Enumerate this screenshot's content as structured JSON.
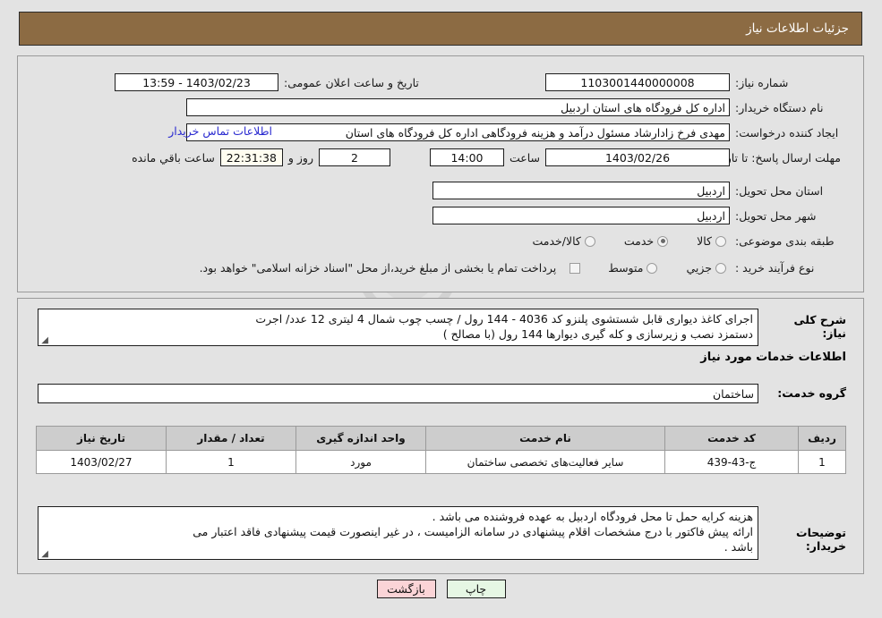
{
  "header": {
    "title": "جزئیات اطلاعات نیاز"
  },
  "form": {
    "need_number_label": "شماره نیاز:",
    "need_number_value": "1103001440000008",
    "public_announce_label": "تاریخ و ساعت اعلان عمومی:",
    "public_announce_value": "1403/02/23 - 13:59",
    "buyer_org_label": "نام دستگاه خریدار:",
    "buyer_org_value": "اداره کل فرودگاه های استان اردبیل",
    "creator_label": "ایجاد کننده درخواست:",
    "creator_value": "مهدی فرخ زادارشاد مسئول درآمد و هزینه فرودگاهی اداره کل فرودگاه های استان",
    "contact_link": "اطلاعات تماس خریدار",
    "deadline_label": "مهلت ارسال پاسخ: تا تاریخ:",
    "deadline_date": "1403/02/26",
    "hour_label": "ساعت",
    "deadline_time": "14:00",
    "days_value": "2",
    "days_label": "روز و",
    "countdown_value": "22:31:38",
    "countdown_label": "ساعت باقي مانده",
    "province_label": "استان محل تحویل:",
    "province_value": "اردبیل",
    "city_label": "شهر محل تحویل:",
    "city_value": "اردبیل",
    "classification_label": "طبقه بندی موضوعی:",
    "classification_options": [
      "کالا",
      "خدمت",
      "کالا/خدمت"
    ],
    "classification_selected": 1,
    "process_type_label": "نوع فرآیند خرید :",
    "process_type_options": [
      "جزیي",
      "متوسط"
    ],
    "process_type_selected": -1,
    "treasury_note": "پرداخت تمام یا بخشی از مبلغ خرید،از محل \"اسناد خزانه اسلامی\" خواهد بود.",
    "treasury_checked": false
  },
  "description": {
    "summary_label": "شرح کلی نیاز:",
    "summary_line1": "اجرای کاغذ دیواری قابل شستشوی پلنزو  کد 4036 - 144 رول / چسب چوب شمال 4 لیتری 12 عدد/ اجرت",
    "summary_line2": "دستمزد نصب و زیرسازی و کله گیری دیوارها 144 رول (با مصالح )",
    "section_heading": "اطلاعات خدمات مورد نیاز",
    "service_group_label": "گروه خدمت:",
    "service_group_value": "ساختمان"
  },
  "items_table": {
    "columns": [
      "ردیف",
      "کد خدمت",
      "نام خدمت",
      "واحد اندازه گیری",
      "تعداد / مقدار",
      "تاریخ نیاز"
    ],
    "rows": [
      {
        "radif": "1",
        "code": "ج-43-439",
        "name": "سایر فعالیت‌های تخصصی ساختمان",
        "unit": "مورد",
        "qty": "1",
        "date": "1403/02/27"
      }
    ]
  },
  "buyer_notes": {
    "label": "توضیحات خریدار:",
    "line1": "هزینه کرایه حمل تا محل فرودگاه اردبیل به عهده فروشنده می باشد .",
    "line2": "ارائه پیش فاکتور با درج مشخصات اقلام پیشنهادی در سامانه الزامیست ، در غیر اینصورت قیمت پیشنهادی فاقد اعتبار می",
    "line3": "باشد ."
  },
  "footer": {
    "print_label": "چاپ",
    "back_label": "بازگشت"
  },
  "watermark": {
    "text": "AriaTender.net"
  },
  "colors": {
    "header_brown": "#8c6b43",
    "page_bg": "#e3e3e3",
    "link_blue": "#2a2ad0",
    "table_header": "#cdcdcd",
    "btn_print_bg": "#e6f7e4",
    "btn_back_bg": "#fbd4d7",
    "countdown_bg": "#fffdf0"
  }
}
